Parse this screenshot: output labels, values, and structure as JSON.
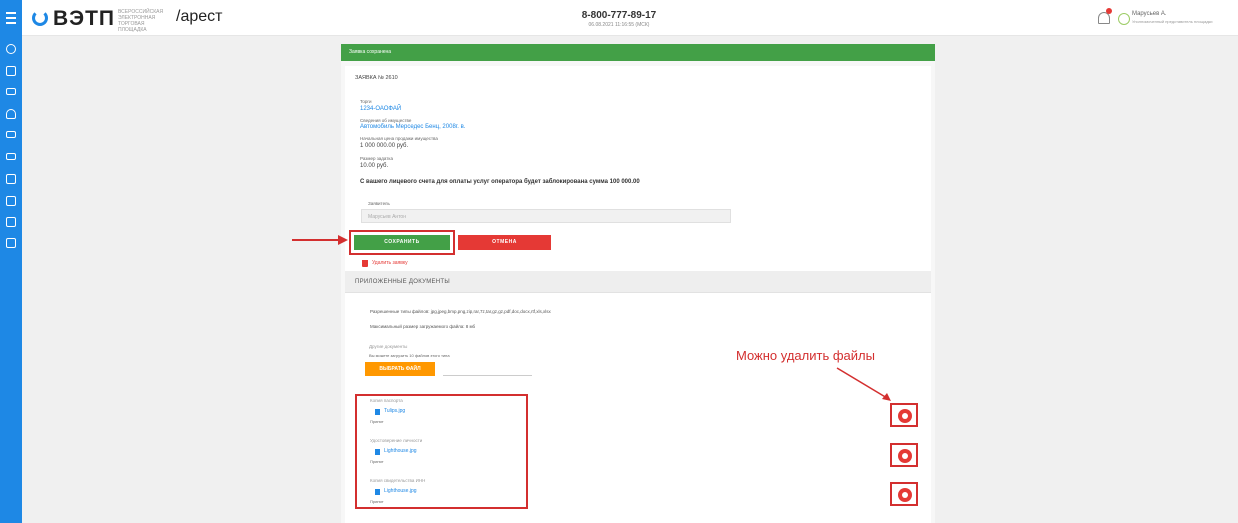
{
  "header": {
    "logo_text": "ВЭТП",
    "logo_subtitle": "ВСЕРОССИЙСКАЯ ЭЛЕКТРОННАЯ ТОРГОВАЯ ПЛОЩАДКА",
    "section": "/арест",
    "phone": "8-800-777-89-17",
    "datetime": "06.08.2021 11:16:55 (МСК)",
    "user_name": "Марусьев А.",
    "user_role": "Уполномоченный представитель площадки"
  },
  "sidebar": {
    "icons": [
      "settings-icon",
      "document-icon",
      "card-icon",
      "user-icon",
      "car-icon",
      "car-icon",
      "doc-stack-icon",
      "list-icon",
      "home-icon",
      "badge-icon"
    ]
  },
  "form": {
    "banner": "Заявка сохранена",
    "request_title": "ЗАЯВКА № 2610",
    "lot_label": "Торги",
    "lot_value": "1234-ОАОФАЙ",
    "property_label": "Сведения об имуществе",
    "property_value": "Автомобиль Мерседес Бенц, 2008г. в.",
    "price_label": "Начальная цена продажи имущества",
    "price_value": "1 000 000.00 руб.",
    "deposit_label": "Размер задатка",
    "deposit_value": "10.00 руб.",
    "notice": "С вашего лицевого счета для оплаты услуг оператора будет заблокирована сумма 100 000.00",
    "applicant_label": "Заявитель",
    "applicant_placeholder": "Марусьев Антон",
    "save_button": "СОХРАНИТЬ",
    "cancel_button": "ОТМЕНА",
    "delete_link": "Удалить заявку"
  },
  "documents": {
    "section_title": "ПРИЛОЖЕННЫЕ ДОКУМЕНТЫ",
    "allowed_types": "Разрешенные типы файлов: jpg,jpeg,bmp,png,zip,rar,7z,tar,gz,gz,pdf,doc,docx,rtf,xls,xlsx",
    "max_size": "Максимальный размер загружаемого файла: 8 мб",
    "other_docs_label": "Другие документы",
    "other_docs_hint": "Вы можете загрузить 10 файлов этого типа",
    "upload_button": "ВЫБРАТЬ ФАЙЛ",
    "files": [
      {
        "category": "Копия паспорта",
        "name": "Tulips.jpg",
        "status": "Принят"
      },
      {
        "category": "Удостоверение личности",
        "name": "Lighthouse.jpg",
        "status": "Принят"
      },
      {
        "category": "Копия свидетельства ИНН",
        "name": "Lighthouse.jpg",
        "status": "Принят"
      }
    ]
  },
  "annotation": "Можно удалить файлы"
}
